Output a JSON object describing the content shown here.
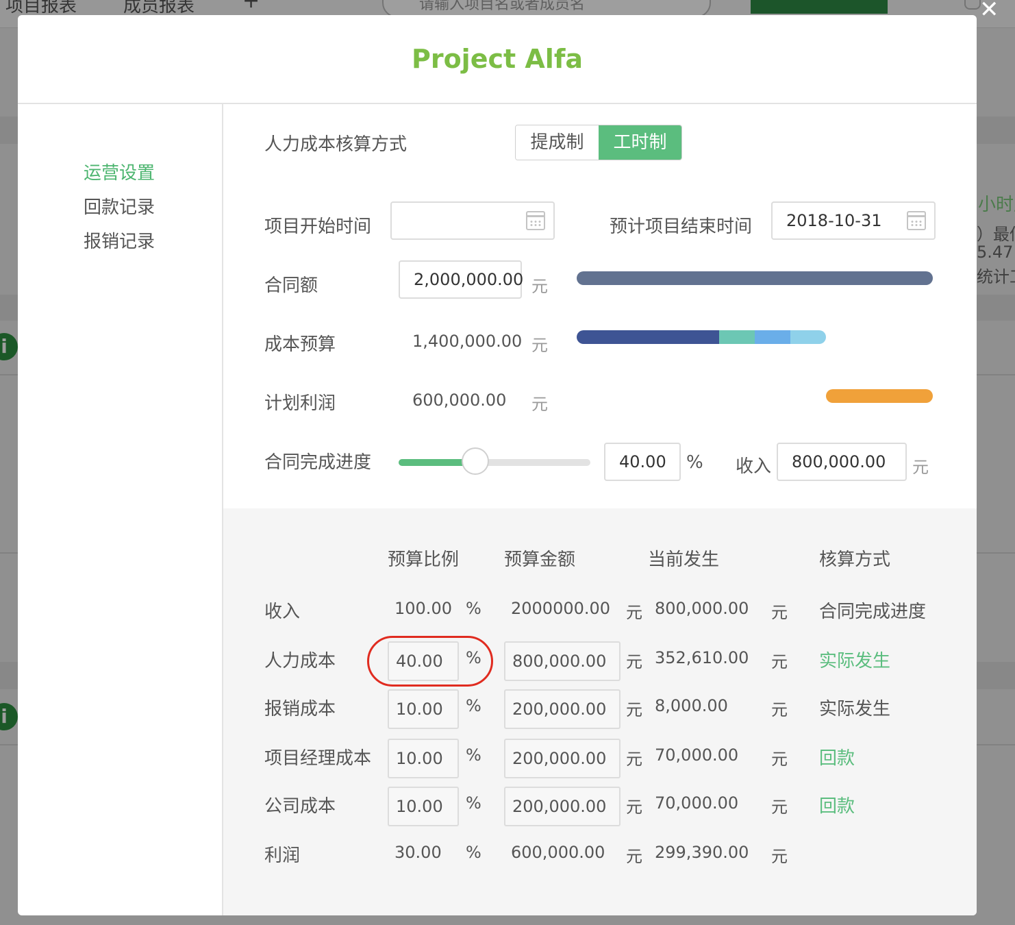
{
  "background": {
    "tabs": [
      "项目报表",
      "成员报表",
      "+"
    ],
    "search_placeholder": "请输入项目名或者成员名",
    "close": "✕",
    "right_texts": [
      "小时产",
      "）最低",
      "5.47",
      "统计工"
    ]
  },
  "modal": {
    "title": "Project Alfa"
  },
  "sidebar": {
    "items": [
      {
        "label": "运营设置"
      },
      {
        "label": "回款记录"
      },
      {
        "label": "报销记录"
      }
    ]
  },
  "settings": {
    "method_label": "人力成本核算方式",
    "method_options": [
      "提成制",
      "工时制"
    ],
    "method_selected": "工时制",
    "start_label": "项目开始时间",
    "start_value": "",
    "end_label": "预计项目结束时间",
    "end_value": "2018-10-31",
    "contract_label": "合同额",
    "contract_value": "2,000,000.00",
    "cost_label": "成本预算",
    "cost_value": "1,400,000.00",
    "profit_label": "计划利润",
    "profit_value": "600,000.00",
    "unit_yuan": "元",
    "progress_label": "合同完成进度",
    "progress_value": "40.00",
    "progress_fraction": 0.4,
    "percent": "%",
    "income_label": "收入",
    "income_value": "800,000.00",
    "colors": {
      "contract_bar": "#627290",
      "cost_bar": [
        "#3e5494",
        "#6cc7b4",
        "#6aaee9",
        "#8fd1ea"
      ],
      "profit_bar": "#f0a13a",
      "accent": "#5bbd7e"
    }
  },
  "budget_table": {
    "headers": [
      "预算比例",
      "预算金额",
      "当前发生",
      "核算方式"
    ],
    "rows": [
      {
        "name": "收入",
        "ratio": "100.00",
        "amount": "2000000.00",
        "current": "800,000.00",
        "method": "合同完成进度",
        "editable": false,
        "method_link": false
      },
      {
        "name": "人力成本",
        "ratio": "40.00",
        "amount": "800,000.00",
        "current": "352,610.00",
        "method": "实际发生",
        "editable": true,
        "method_link": true
      },
      {
        "name": "报销成本",
        "ratio": "10.00",
        "amount": "200,000.00",
        "current": "8,000.00",
        "method": "实际发生",
        "editable": true,
        "method_link": false
      },
      {
        "name": "项目经理成本",
        "ratio": "10.00",
        "amount": "200,000.00",
        "current": "70,000.00",
        "method": "回款",
        "editable": true,
        "method_link": true
      },
      {
        "name": "公司成本",
        "ratio": "10.00",
        "amount": "200,000.00",
        "current": "70,000.00",
        "method": "回款",
        "editable": true,
        "method_link": true
      },
      {
        "name": "利润",
        "ratio": "30.00",
        "amount": "600,000.00",
        "current": "299,390.00",
        "method": "",
        "editable": false,
        "method_link": false
      }
    ],
    "unit_percent": "%",
    "unit_yuan": "元"
  }
}
